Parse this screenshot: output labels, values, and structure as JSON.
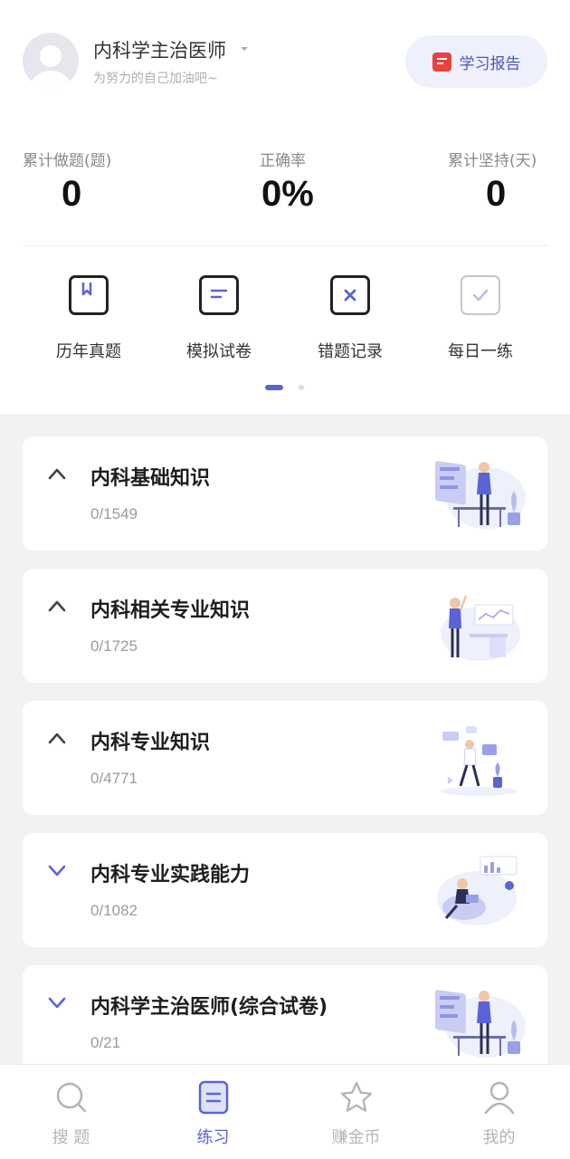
{
  "header": {
    "title": "内科学主治医师",
    "subtitle": "为努力的自己加油吧~",
    "report_button": "学习报告"
  },
  "stats": [
    {
      "label": "累计做题(题)",
      "value": "0"
    },
    {
      "label": "正确率",
      "value": "0%"
    },
    {
      "label": "累计坚持(天)",
      "value": "0"
    }
  ],
  "quick_actions": [
    {
      "label": "历年真题",
      "icon": "bookmark-book-icon"
    },
    {
      "label": "模拟试卷",
      "icon": "exam-paper-icon"
    },
    {
      "label": "错题记录",
      "icon": "wrong-mark-icon"
    },
    {
      "label": "每日一练",
      "icon": "daily-check-icon"
    }
  ],
  "pager": {
    "pages": 2,
    "current": 1
  },
  "subjects": [
    {
      "title": "内科基础知识",
      "count": "0/1549",
      "expanded": true
    },
    {
      "title": "内科相关专业知识",
      "count": "0/1725",
      "expanded": true
    },
    {
      "title": "内科专业知识",
      "count": "0/4771",
      "expanded": true
    },
    {
      "title": "内科专业实践能力",
      "count": "0/1082",
      "expanded": false
    },
    {
      "title": "内科学主治医师(综合试卷)",
      "count": "0/21",
      "expanded": false
    }
  ],
  "tabbar": [
    {
      "label": "搜 题",
      "icon": "search-icon"
    },
    {
      "label": "练习",
      "icon": "practice-icon",
      "active": true
    },
    {
      "label": "赚金币",
      "icon": "star-icon"
    },
    {
      "label": "我的",
      "icon": "user-icon"
    }
  ],
  "colors": {
    "accent": "#5a64d6",
    "report_bg": "#eef0fb",
    "report_icon": "#e8423f",
    "page_bg": "#f2f2f4",
    "chevron_collapsed": "#5a64d6",
    "chevron_expanded": "#444444"
  }
}
